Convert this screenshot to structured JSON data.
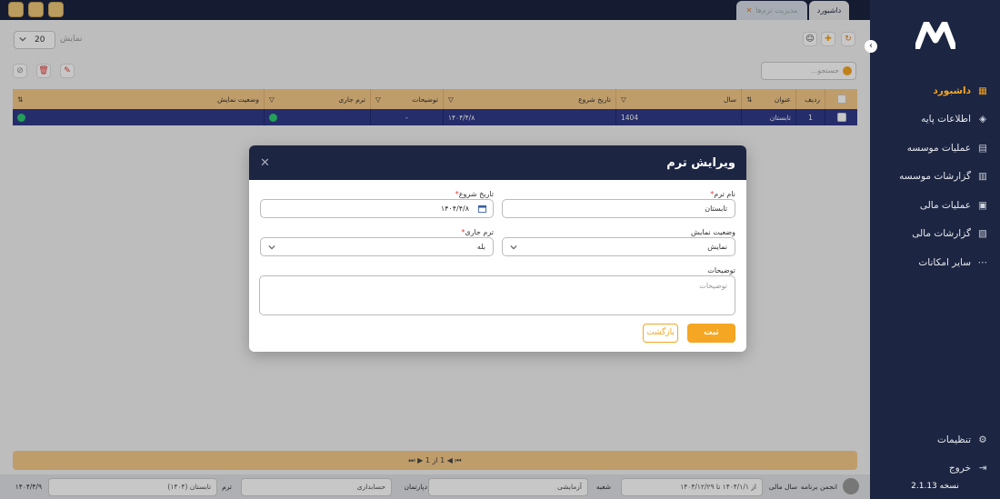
{
  "sidebar": {
    "items": [
      {
        "label": "داشبورد",
        "icon": "dashboard-icon",
        "active": true
      },
      {
        "label": "اطلاعات پایه",
        "icon": "layers-icon"
      },
      {
        "label": "عملیات موسسه",
        "icon": "clipboard-icon"
      },
      {
        "label": "گزارشات موسسه",
        "icon": "bar-chart-icon"
      },
      {
        "label": "عملیات مالی",
        "icon": "wallet-icon"
      },
      {
        "label": "گزارشات مالی",
        "icon": "finance-report-icon"
      },
      {
        "label": "سایر امکانات",
        "icon": "more-icon"
      }
    ],
    "bottom": [
      {
        "label": "تنظیمات",
        "icon": "gear-icon"
      },
      {
        "label": "خروج",
        "icon": "logout-icon"
      }
    ],
    "version": "نسخه 2.1.13",
    "accent": "#f5a623",
    "bg": "#1c2541"
  },
  "tabs": {
    "dashboard": "داشبورد",
    "term_management": "مدیریت ترم‌ها"
  },
  "toolbar": {
    "page_size": "20",
    "show_label": "نمایش",
    "search_placeholder": "جستجو..."
  },
  "table": {
    "headers": [
      "ردیف",
      "عنوان",
      "سال",
      "تاریخ شروع",
      "توضیحات",
      "ترم جاری",
      "وضعیت نمایش"
    ],
    "rows": [
      {
        "index": "1",
        "title": "تابستان",
        "year": "1404",
        "start_date": "۱۴۰۴/۴/۸",
        "description": "-"
      }
    ]
  },
  "pagination": {
    "text": "1 از 1"
  },
  "status_bar": {
    "date": "۱۴۰۴/۴/۹",
    "user_name": "انجمن برنامه",
    "fiscal_year_label": "سال مالی",
    "fiscal_year_value": "از ۱۴۰۴/۱/۱ تا ۱۴۰۴/۱۲/۲۹",
    "branch_label": "شعبه",
    "branch_value": "آزمایشی",
    "department_label": "دپارتمان",
    "department_value": "حسابداری",
    "term_label": "ترم",
    "term_value": "تابستان (۱۴۰۴)"
  },
  "modal": {
    "title": "ویرایش ترم",
    "term_name_label": "نام ترم",
    "term_name_value": "تابستان",
    "start_date_label": "تاریخ شروع",
    "start_date_value": "۱۴۰۴/۴/۸",
    "display_status_label": "وضعیت نمایش",
    "display_status_value": "نمایش",
    "current_term_label": "ترم جاری",
    "current_term_value": "بله",
    "description_label": "توضیحات",
    "description_placeholder": "توضیحات",
    "save_label": "ثبت اطلاعات",
    "back_label": "بازگشت"
  }
}
